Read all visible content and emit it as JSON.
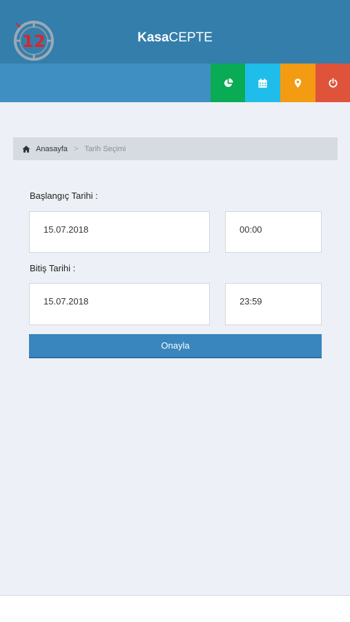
{
  "header": {
    "logo_text": "12",
    "title_bold": "Kasa",
    "title_light": "CEPTE"
  },
  "toolbar": {
    "buttons": [
      {
        "icon": "pie-chart-icon",
        "color": "#0aab55"
      },
      {
        "icon": "calendar-icon",
        "color": "#1fbde9"
      },
      {
        "icon": "map-marker-icon",
        "color": "#f39b12"
      },
      {
        "icon": "power-icon",
        "color": "#df533b"
      }
    ]
  },
  "breadcrumb": {
    "home": "Anasayfa",
    "separator": ">",
    "current": "Tarih Seçimi"
  },
  "form": {
    "start_label": "Başlangıç Tarihi :",
    "start_date": "15.07.2018",
    "start_time": "00:00",
    "end_label": "Bitiş Tarihi :",
    "end_date": "15.07.2018",
    "end_time": "23:59",
    "confirm_label": "Onayla"
  },
  "colors": {
    "header_bg": "#347eac",
    "toolbar_bg": "#3f8fc2",
    "button_bg": "#3886bd",
    "logo_red": "#d9262c"
  }
}
